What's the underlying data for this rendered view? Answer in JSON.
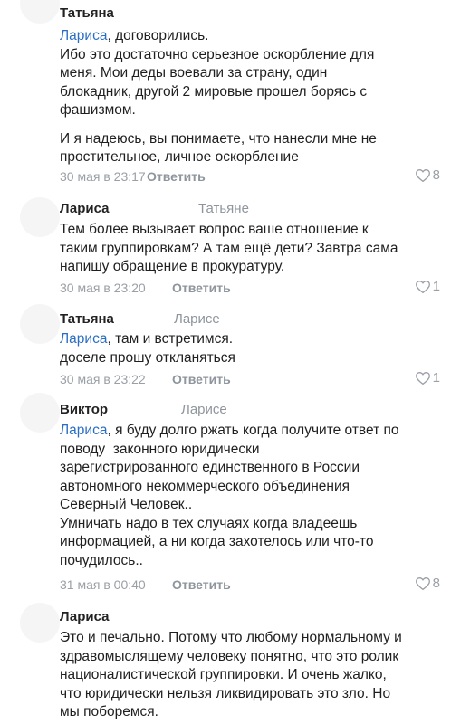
{
  "comments": [
    {
      "author": "Татьяна",
      "reply_to": "",
      "lines": [
        {
          "mention": "Лариса",
          "text": ", договорились."
        },
        {
          "text": "Ибо это достаточно серьезное оскорбление для"
        },
        {
          "text": "меня. Мои деды воевали за страну, один"
        },
        {
          "text": "блокадник, другой 2 мировые прошел борясь с"
        },
        {
          "text": "фашизмом."
        },
        {
          "gap": true
        },
        {
          "text": "И я надеюсь, вы понимаете, что нанесли мне не"
        },
        {
          "text": "простительное, личное оскорбление"
        }
      ],
      "time": "30 мая в 23:17",
      "reply_label": "Ответить",
      "likes": "8"
    },
    {
      "author": "Лариса",
      "reply_to": "Татьяне",
      "lines": [
        {
          "text": "Тем более вызывает вопрос ваше отношение к"
        },
        {
          "text": "таким группировкам? А там ещё дети? Завтра сама"
        },
        {
          "text": "напишу обращение в прокуратуру."
        }
      ],
      "time": "30 мая в 23:20",
      "reply_label": "Ответить",
      "likes": "1"
    },
    {
      "author": "Татьяна",
      "reply_to": "Ларисе",
      "lines": [
        {
          "mention": "Лариса",
          "text": ", там и встретимся."
        },
        {
          "text": "доселе прошу откланяться"
        }
      ],
      "time": "30 мая в 23:22",
      "reply_label": "Ответить",
      "likes": "1"
    },
    {
      "author": "Виктор",
      "reply_to": "Ларисе",
      "lines": [
        {
          "mention": "Лариса",
          "text": ", я буду долго ржать когда получите ответ по"
        },
        {
          "text": "поводу  законного юридически"
        },
        {
          "text": "зарегистрированного единственного в России"
        },
        {
          "text": "автономного некоммерческого объединения"
        },
        {
          "text": "Северный Человек.."
        },
        {
          "text": "Умничать надо в тех случаях когда владеешь"
        },
        {
          "text": "информацией, а ни когда захотелось или что-то"
        },
        {
          "text": "почудилось.."
        }
      ],
      "time": "31 мая в 00:40",
      "reply_label": "Ответить",
      "likes": "8"
    },
    {
      "author": "Лариса",
      "reply_to": "",
      "lines": [
        {
          "text": "Это и печально. Потому что любому нормальному и"
        },
        {
          "text": "здравомыслящему человеку понятно, что это ролик"
        },
        {
          "text": "националистической группировки. И очень жалко,"
        },
        {
          "text": "что юридически нельзя ликвидировать это зло. Но"
        },
        {
          "text": "мы поборемся."
        }
      ],
      "time": "",
      "reply_label": "",
      "likes": ""
    }
  ],
  "colors": {
    "mention": "#2a6ec4",
    "meta": "#9aa0a6",
    "text": "#1f1f1f"
  },
  "icons": {
    "like": "heart-icon"
  }
}
